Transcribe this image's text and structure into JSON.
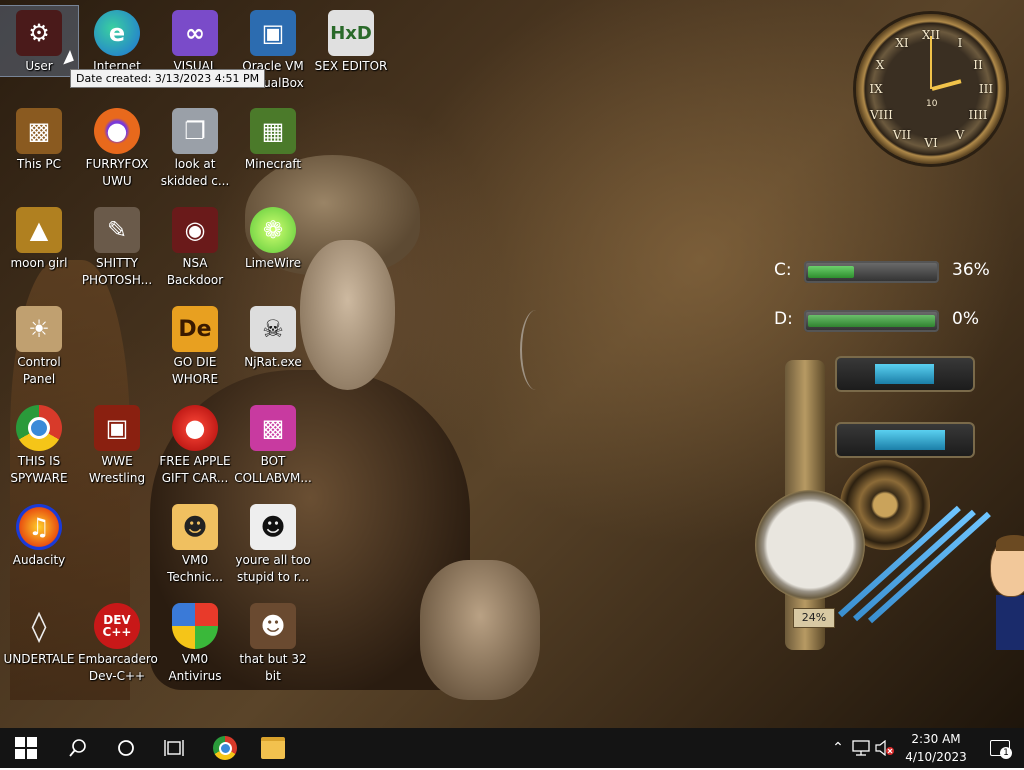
{
  "desktop": {
    "icons": [
      {
        "label": "User",
        "icon": "user-folder-icon",
        "color": "#4a1a1a"
      },
      {
        "label": "Internet",
        "icon": "edge-icon",
        "color": "#1f8ddb"
      },
      {
        "label": "VISUAL",
        "icon": "visual-studio-icon",
        "color": "#7a4bc9"
      },
      {
        "label": "Oracle VM VirtualBox",
        "icon": "virtualbox-icon",
        "color": "#2c6cb0"
      },
      {
        "label": "SEX EDITOR",
        "icon": "hxd-icon",
        "color": "#e0e0e0"
      },
      {
        "label": "This PC",
        "icon": "computer-icon",
        "color": "#8a5a20"
      },
      {
        "label": "FURRYFOX UWU",
        "icon": "firefox-icon",
        "color": "#e8691c"
      },
      {
        "label": "look at skidded c...",
        "icon": "windows-stack-icon",
        "color": "#9aa0a8"
      },
      {
        "label": "Minecraft",
        "icon": "minecraft-icon",
        "color": "#4b7a2a"
      },
      {
        "label": "moon girl",
        "icon": "folder-icon",
        "color": "#b08020"
      },
      {
        "label": "SHITTY PHOTOSH...",
        "icon": "gimp-icon",
        "color": "#6a5a4a"
      },
      {
        "label": "NSA Backdoor",
        "icon": "nsa-icon",
        "color": "#6a1a1a"
      },
      {
        "label": "LimeWire",
        "icon": "limewire-icon",
        "color": "#5ac83a"
      },
      {
        "label": "Control Panel",
        "icon": "control-panel-icon",
        "color": "#c0a070"
      },
      {
        "label": "GO DIE WHORE",
        "icon": "de-icon",
        "color": "#e8a020"
      },
      {
        "label": "NjRat.exe",
        "icon": "skull-icon",
        "color": "#dddddd"
      },
      {
        "label": "THIS IS SPYWARE",
        "icon": "chrome-icon",
        "color": "#3a8ad8"
      },
      {
        "label": "WWE Wrestling",
        "icon": "tv-icon",
        "color": "#8a2010"
      },
      {
        "label": "FREE APPLE GIFT CAR...",
        "icon": "apple-icon",
        "color": "#c81010"
      },
      {
        "label": "BOT COLLABVM...",
        "icon": "monitor-pink-icon",
        "color": "#c83aa0"
      },
      {
        "label": "Audacity",
        "icon": "audacity-icon",
        "color": "#e85010"
      },
      {
        "label": "VM0 Technic...",
        "icon": "support-person-icon",
        "color": "#f0c060"
      },
      {
        "label": "youre all too stupid to r...",
        "icon": "portrait-icon",
        "color": "#eeeeee"
      },
      {
        "label": "UNDERTALE",
        "icon": "unity-icon",
        "color": "#dddddd"
      },
      {
        "label": "Embarcadero Dev-C++",
        "icon": "devcpp-icon",
        "color": "#c81818"
      },
      {
        "label": "VM0 Antivirus",
        "icon": "shield-icon",
        "color": "#3a7ad8"
      },
      {
        "label": "that but 32 bit",
        "icon": "portrait-lady-icon",
        "color": "#6a4a30"
      }
    ],
    "tooltip": "Date created: 3/13/2023 4:51 PM"
  },
  "gadgets": {
    "clock": {
      "numerals": [
        "XII",
        "I",
        "II",
        "III",
        "IIII",
        "V",
        "VI",
        "VII",
        "VIII",
        "IX",
        "X",
        "XI"
      ],
      "subdial": "10",
      "time": "2:30"
    },
    "drives": [
      {
        "letter": "C:",
        "percent_text": "36%",
        "percent": 36
      },
      {
        "letter": "D:",
        "percent_text": "0%",
        "percent": 0
      }
    ],
    "meters": [
      {
        "level": 0.42
      },
      {
        "level": 0.5
      }
    ],
    "gauge_value": "24%"
  },
  "taskbar": {
    "start": "start-icon",
    "search": "search-icon",
    "cortana": "cortana-icon",
    "task_view": "task-view-icon",
    "pinned": [
      "chrome-icon",
      "file-explorer-icon"
    ],
    "tray": [
      "chevron-up-icon",
      "network-icon",
      "volume-muted-icon"
    ],
    "time": "2:30 AM",
    "date": "4/10/2023",
    "notifications_count": "1"
  },
  "colors": {
    "taskbar": "#141414",
    "accent_tooltip": "#f2f2f2"
  }
}
